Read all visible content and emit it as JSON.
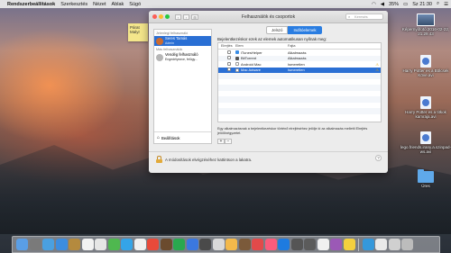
{
  "menubar": {
    "app_name": "Rendszerbeállítások",
    "items": [
      "Szerkesztés",
      "Nézet",
      "Ablak",
      "Súgó"
    ],
    "battery": "35%",
    "time": "Sz 21:30"
  },
  "sticky": {
    "text": "Párat Malyr"
  },
  "window": {
    "title": "Felhasználók és csoportok",
    "search_placeholder": "Keresés"
  },
  "sidebar": {
    "current_header": "Jelenlegi felhasználó",
    "current_user": {
      "name": "Seres Tamás",
      "role": "Admin"
    },
    "other_header": "Más felhasználók",
    "other_user": {
      "name": "Vendég felhasználó",
      "role": "Engedélyezve, felügy..."
    },
    "bottom_label": "Beállítások"
  },
  "tabs": [
    {
      "label": "Jelszó",
      "active": false
    },
    {
      "label": "Indítóelemek",
      "active": true
    }
  ],
  "panel": {
    "description": "Bejelentkezéskor ezek az elemek automatikusan nyílnak meg:",
    "columns": {
      "hide": "Elrejtés",
      "item": "Elem",
      "kind": "Fajta"
    },
    "rows": [
      {
        "name": "iTunesHelper",
        "kind": "Alkalmazás",
        "warning": false,
        "icon_color": "#3a8ee6",
        "alt": false,
        "selected": false
      },
      {
        "name": "BitTorrent",
        "kind": "Alkalmazás",
        "warning": false,
        "icon_color": "#555555",
        "alt": true,
        "selected": false
      },
      {
        "name": "Android Mac",
        "kind": "Ismeretlen",
        "warning": true,
        "icon_color": "#ffffff",
        "alt": false,
        "selected": false
      },
      {
        "name": "Mac Adware",
        "kind": "Ismeretlen",
        "warning": true,
        "icon_color": "#ffffff",
        "alt": false,
        "selected": true
      }
    ],
    "help_text": "Egy alkalmazásnak a bejelentkezéskor történő elrejtéséhez jelölje ki az alkalmazás melletti Elrejtés jelölőnégyzetet.",
    "add_label": "+",
    "remove_label": "−"
  },
  "lockbar": {
    "text": "A módosítások elvégzéséhez kattintson a lakatra.",
    "help_label": "?"
  },
  "desktop_files": [
    {
      "label": "Képernyőfotó 2016-02-22, 21.29.43",
      "type": "image"
    },
    {
      "label": "Harry Potter es a Bölcsek Köve.avi",
      "type": "video"
    },
    {
      "label": "Harry Potter es a titkok kamraja.avi",
      "type": "video"
    },
    {
      "label": "lego.friends.irany.a.szinpad-ws.avi",
      "type": "video"
    },
    {
      "label": "Üres",
      "type": "folder"
    }
  ],
  "dock": {
    "colors": [
      "#5a9ee6",
      "#7a7a7a",
      "#4aa0e0",
      "#3c8de0",
      "#b48a3e",
      "#f2f2f2",
      "#e6e6e6",
      "#4fb84f",
      "#34a4e8",
      "#f0f0f0",
      "#e84a3a",
      "#6b4b2e",
      "#29a84e",
      "#3b78e0",
      "#4a4a4a",
      "#d9d9d9",
      "#f3b94b",
      "#7b5a3a",
      "#e24a4a",
      "#fa5c7c",
      "#1e7be0",
      "#555555",
      "#5b5b5b",
      "#f0f0f0",
      "#9b59b6",
      "#f4d03f",
      "#3498db",
      "#e9e9e9",
      "#d0d0d0",
      "#bcbcbc"
    ]
  }
}
